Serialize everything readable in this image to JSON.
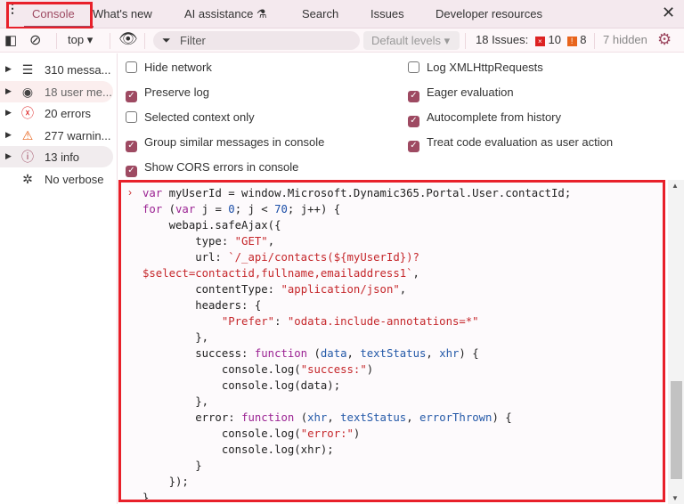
{
  "tabs": [
    "Console",
    "What's new",
    "AI assistance",
    "Search",
    "Issues",
    "Developer resources"
  ],
  "toolbar": {
    "context": "top",
    "filter_placeholder": "Filter",
    "levels": "Default levels",
    "issues_label": "18 Issues:",
    "errors_count": "10",
    "warnings_count": "8",
    "hidden": "7 hidden"
  },
  "sidebar": [
    {
      "label": "310 messa...",
      "icon": "list-icon"
    },
    {
      "label": "18 user me...",
      "icon": "user-icon"
    },
    {
      "label": "20 errors",
      "icon": "error-icon"
    },
    {
      "label": "277 warnin...",
      "icon": "warning-icon"
    },
    {
      "label": "13 info",
      "icon": "info-icon"
    },
    {
      "label": "No verbose",
      "icon": "bug-icon"
    }
  ],
  "settings": [
    {
      "label": "Hide network",
      "checked": false
    },
    {
      "label": "Preserve log",
      "checked": true
    },
    {
      "label": "Selected context only",
      "checked": false
    },
    {
      "label": "Group similar messages in console",
      "checked": true
    },
    {
      "label": "Show CORS errors in console",
      "checked": true
    },
    {
      "label": "Log XMLHttpRequests",
      "checked": false
    },
    {
      "label": "Eager evaluation",
      "checked": true
    },
    {
      "label": "Autocomplete from history",
      "checked": true
    },
    {
      "label": "Treat code evaluation as user action",
      "checked": true
    }
  ],
  "code": [
    [
      [
        "k",
        "var "
      ],
      [
        "",
        "myUserId = window.Microsoft.Dynamic365.Portal.User.contactId;"
      ]
    ],
    [
      [
        "k",
        "for "
      ],
      [
        "",
        "("
      ],
      [
        "k",
        "var "
      ],
      [
        "",
        "j = "
      ],
      [
        "n",
        "0"
      ],
      [
        "",
        "; j < "
      ],
      [
        "n",
        "70"
      ],
      [
        "",
        "; j++) {"
      ]
    ],
    [
      [
        "",
        "    webapi.safeAjax({"
      ]
    ],
    [
      [
        "",
        "        type: "
      ],
      [
        "s",
        "\"GET\""
      ],
      [
        "",
        ","
      ]
    ],
    [
      [
        "",
        "        url: "
      ],
      [
        "s",
        "`/_api/contacts(${myUserId})?"
      ]
    ],
    [
      [
        "s",
        "$select=contactid,fullname,emailaddress1`"
      ],
      [
        "",
        ","
      ]
    ],
    [
      [
        "",
        "        contentType: "
      ],
      [
        "s",
        "\"application/json\""
      ],
      [
        "",
        ","
      ]
    ],
    [
      [
        "",
        "        headers: {"
      ]
    ],
    [
      [
        "",
        "            "
      ],
      [
        "s",
        "\"Prefer\""
      ],
      [
        "",
        ": "
      ],
      [
        "s",
        "\"odata.include-annotations=*\""
      ]
    ],
    [
      [
        "",
        "        },"
      ]
    ],
    [
      [
        "",
        "        success: "
      ],
      [
        "k",
        "function "
      ],
      [
        "",
        "("
      ],
      [
        "v",
        "data"
      ],
      [
        "",
        ", "
      ],
      [
        "v",
        "textStatus"
      ],
      [
        "",
        ", "
      ],
      [
        "v",
        "xhr"
      ],
      [
        "",
        ") {"
      ]
    ],
    [
      [
        "",
        "            console.log("
      ],
      [
        "s",
        "\"success:\""
      ],
      [
        "",
        ")"
      ]
    ],
    [
      [
        "",
        "            console.log(data);"
      ]
    ],
    [
      [
        "",
        "        },"
      ]
    ],
    [
      [
        "",
        "        error: "
      ],
      [
        "k",
        "function "
      ],
      [
        "",
        "("
      ],
      [
        "v",
        "xhr"
      ],
      [
        "",
        ", "
      ],
      [
        "v",
        "textStatus"
      ],
      [
        "",
        ", "
      ],
      [
        "v",
        "errorThrown"
      ],
      [
        "",
        ") {"
      ]
    ],
    [
      [
        "",
        "            console.log("
      ],
      [
        "s",
        "\"error:\""
      ],
      [
        "",
        ")"
      ]
    ],
    [
      [
        "",
        "            console.log(xhr);"
      ]
    ],
    [
      [
        "",
        "        }"
      ]
    ],
    [
      [
        "",
        "    });"
      ]
    ],
    [
      [
        "",
        "}"
      ]
    ]
  ]
}
